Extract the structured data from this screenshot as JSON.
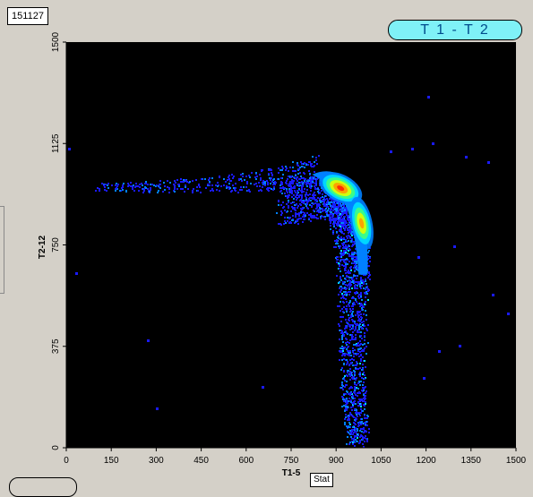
{
  "event_count": "151127",
  "plot_title": "T 1 - T 2",
  "stat_button": "Stat",
  "colors": {
    "window_bg": "#d4d0c8",
    "plot_bg": "#000000",
    "title_fill": "#7ff1f7",
    "title_text": "#004c8c",
    "density_scale": [
      "#1a1aff",
      "#0080ff",
      "#00e0ff",
      "#40ff80",
      "#e0ff00",
      "#ff9900",
      "#ff2000"
    ]
  },
  "chart_data": {
    "type": "heatmap",
    "title": "T 1 - T 2",
    "xlabel": "T1-5",
    "ylabel": "T2-12",
    "xlim": [
      0,
      1500
    ],
    "ylim": [
      0,
      1500
    ],
    "xticks": [
      "0",
      "150",
      "300",
      "450",
      "600",
      "750",
      "900",
      "1050",
      "1200",
      "1350",
      "1500"
    ],
    "yticks": [
      "0",
      "375",
      "750",
      "1125",
      "1500"
    ],
    "grid": false,
    "legend": "none",
    "density_peaks": [
      {
        "x": 915,
        "y": 960,
        "level": 1.0
      },
      {
        "x": 985,
        "y": 830,
        "level": 0.85
      }
    ],
    "population_trace": [
      {
        "x": 100,
        "y": 960
      },
      {
        "x": 300,
        "y": 960
      },
      {
        "x": 500,
        "y": 965
      },
      {
        "x": 650,
        "y": 975
      },
      {
        "x": 750,
        "y": 990
      },
      {
        "x": 830,
        "y": 1010
      },
      {
        "x": 900,
        "y": 1000
      },
      {
        "x": 950,
        "y": 960
      },
      {
        "x": 980,
        "y": 890
      },
      {
        "x": 995,
        "y": 800
      },
      {
        "x": 1000,
        "y": 700
      },
      {
        "x": 1000,
        "y": 600
      },
      {
        "x": 990,
        "y": 450
      },
      {
        "x": 985,
        "y": 300
      },
      {
        "x": 990,
        "y": 150
      },
      {
        "x": 995,
        "y": 20
      }
    ],
    "outliers": [
      {
        "x": 1205,
        "y": 1300
      },
      {
        "x": 1405,
        "y": 1060
      },
      {
        "x": 1170,
        "y": 710
      },
      {
        "x": 1290,
        "y": 750
      },
      {
        "x": 1420,
        "y": 570
      },
      {
        "x": 1470,
        "y": 500
      },
      {
        "x": 1240,
        "y": 360
      },
      {
        "x": 1310,
        "y": 380
      },
      {
        "x": 1190,
        "y": 260
      },
      {
        "x": 270,
        "y": 400
      },
      {
        "x": 650,
        "y": 230
      },
      {
        "x": 300,
        "y": 150
      },
      {
        "x": 1220,
        "y": 1130
      },
      {
        "x": 1150,
        "y": 1110
      },
      {
        "x": 5,
        "y": 1110
      },
      {
        "x": 30,
        "y": 650
      },
      {
        "x": 1080,
        "y": 1100
      },
      {
        "x": 1330,
        "y": 1080
      }
    ]
  }
}
